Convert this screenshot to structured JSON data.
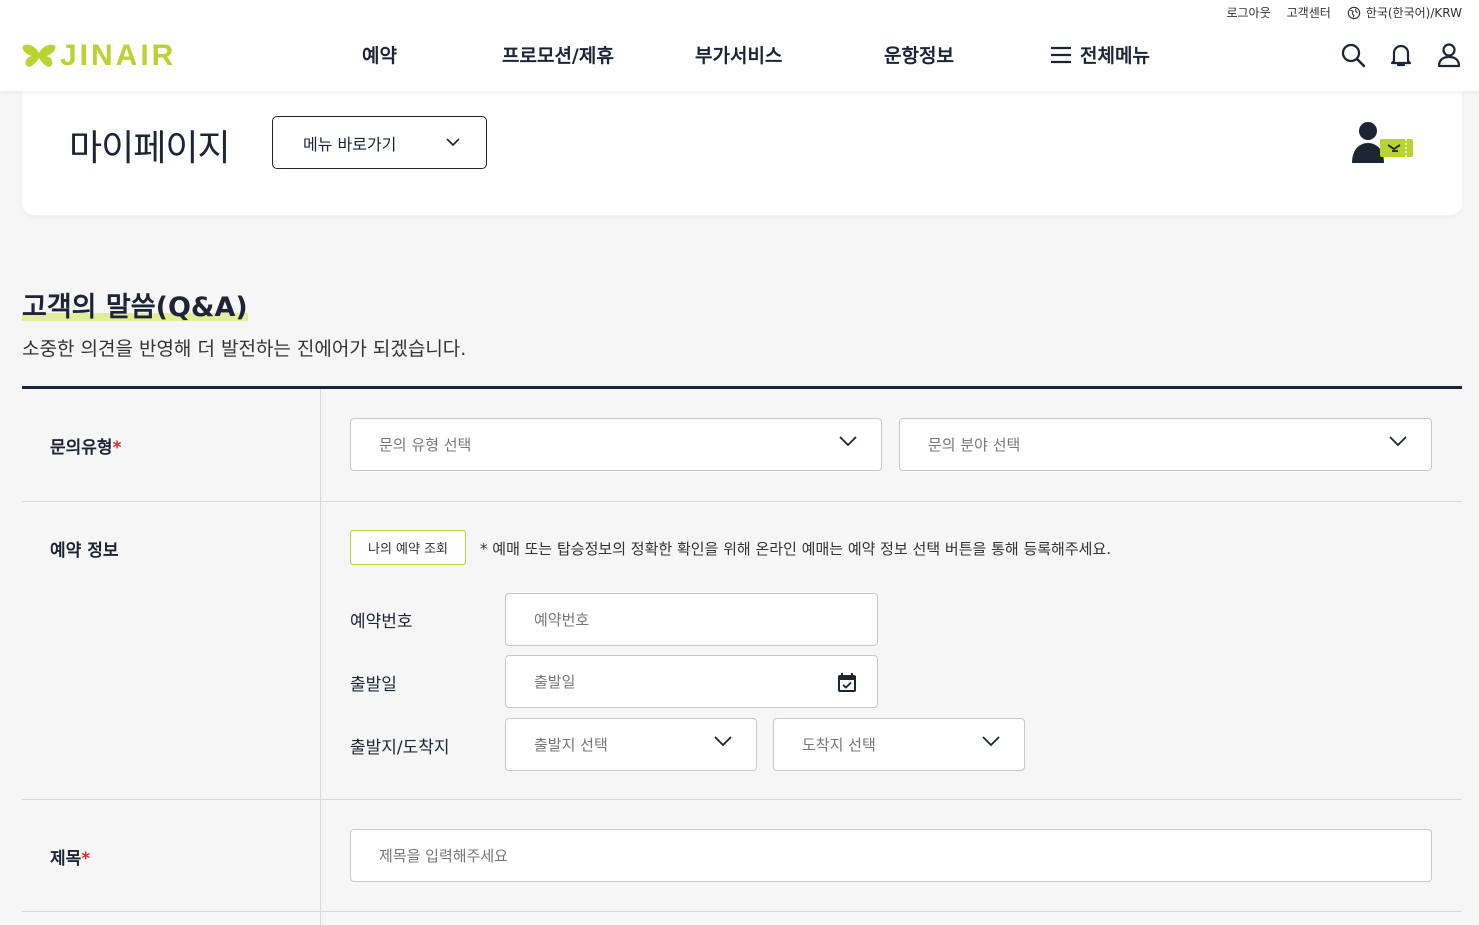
{
  "header": {
    "util": {
      "logout": "로그아웃",
      "customer_center": "고객센터",
      "language": "한국(한국어)/KRW"
    },
    "logo_text": "JINAIR",
    "nav": [
      "예약",
      "프로모션/제휴",
      "부가서비스",
      "운항정보",
      "전체메뉴"
    ],
    "icons": [
      "search-icon",
      "bell-icon",
      "user-icon"
    ]
  },
  "mypage": {
    "title": "마이페이지",
    "shortcut_label": "메뉴 바로가기"
  },
  "section": {
    "title": "고객의 말씀(Q&A)",
    "subtitle": "소중한 의견을 반영해 더 발전하는 진에어가 되겠습니다."
  },
  "form": {
    "inquiry_type": {
      "label": "문의유형",
      "required_mark": "*",
      "type_placeholder": "문의 유형 선택",
      "field_placeholder": "문의 분야 선택"
    },
    "reservation": {
      "label": "예약 정보",
      "lookup_button": "나의 예약 조회",
      "notice": "* 예매 또는 탑승정보의 정확한 확인을 위해 온라인 예매는 예약 정보 선택 버튼을 통해 등록해주세요.",
      "number_label": "예약번호",
      "number_placeholder": "예약번호",
      "date_label": "출발일",
      "date_placeholder": "출발일",
      "route_label": "출발지/도착지",
      "origin_placeholder": "출발지 선택",
      "destination_placeholder": "도착지 선택"
    },
    "subject": {
      "label": "제목",
      "required_mark": "*",
      "placeholder": "제목을 입력해주세요"
    }
  },
  "colors": {
    "brand": "#b7d433",
    "navy": "#1d2433",
    "required": "#e0282e",
    "highlight": "#e3ec9b"
  }
}
